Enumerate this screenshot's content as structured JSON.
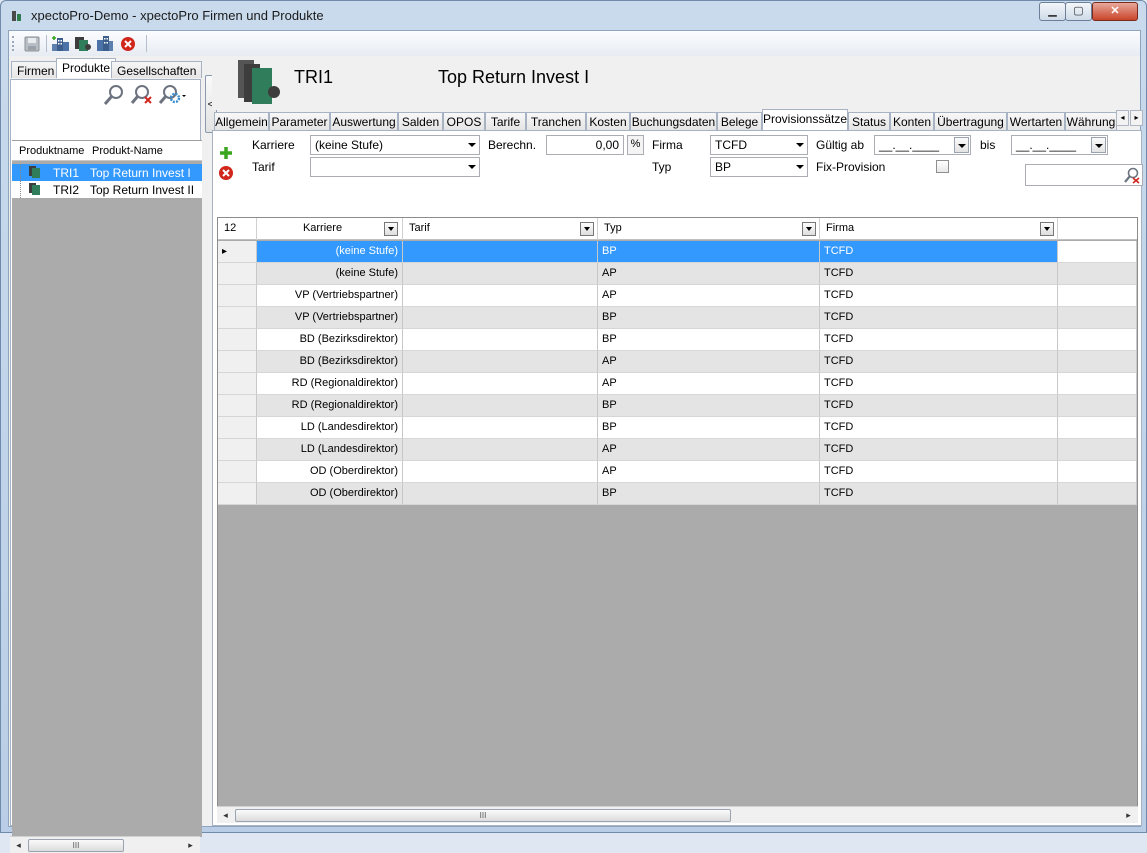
{
  "window": {
    "title": "xpectoPro-Demo - xpectoPro Firmen und Produkte",
    "min_glyph": "▁",
    "max_glyph": "▢",
    "close_glyph": "✕"
  },
  "left": {
    "tabs": [
      "Firmen",
      "Produkte",
      "Gesellschaften"
    ],
    "active_tab": "Produkte",
    "columns": [
      "Produktname",
      "Produkt-Name"
    ],
    "rows": [
      {
        "code": "TRI1",
        "name": "Top Return Invest I",
        "selected": true
      },
      {
        "code": "TRI2",
        "name": "Top Return Invest II",
        "selected": false
      }
    ],
    "scroll_thumb": "III"
  },
  "collapse_glyph": "<",
  "product": {
    "code": "TRI1",
    "name": "Top Return Invest I"
  },
  "tabs": [
    "Allgemein",
    "Parameter",
    "Auswertung",
    "Salden",
    "OPOS",
    "Tarife",
    "Tranchen",
    "Kosten",
    "Buchungsdaten",
    "Belege",
    "Provisionssätze",
    "Status",
    "Konten",
    "Übertragung",
    "Wertarten",
    "Währung"
  ],
  "active_tab": "Provisionssätze",
  "tab_nav": {
    "left": "◂",
    "right": "▸"
  },
  "filters": {
    "karriere_label": "Karriere",
    "karriere_value": "(keine Stufe)",
    "tarif_label": "Tarif",
    "tarif_value": "",
    "berechn_label": "Berechn.",
    "berechn_value": "0,00",
    "pct_label": "%",
    "firma_label": "Firma",
    "firma_value": "TCFD",
    "typ_label": "Typ",
    "typ_value": "BP",
    "gueltig_label": "Gültig ab",
    "gueltig_value": "__.__.____",
    "bis_label": "bis",
    "bis_value": "__.__.____",
    "fix_label": "Fix-Provision"
  },
  "grid": {
    "count": "12",
    "columns": [
      "Karriere",
      "Tarif",
      "Typ",
      "Firma"
    ],
    "rows": [
      {
        "karriere": "(keine Stufe)",
        "tarif": "",
        "typ": "BP",
        "firma": "TCFD"
      },
      {
        "karriere": "(keine Stufe)",
        "tarif": "",
        "typ": "AP",
        "firma": "TCFD"
      },
      {
        "karriere": "VP (Vertriebspartner)",
        "tarif": "",
        "typ": "AP",
        "firma": "TCFD"
      },
      {
        "karriere": "VP (Vertriebspartner)",
        "tarif": "",
        "typ": "BP",
        "firma": "TCFD"
      },
      {
        "karriere": "BD (Bezirksdirektor)",
        "tarif": "",
        "typ": "BP",
        "firma": "TCFD"
      },
      {
        "karriere": "BD (Bezirksdirektor)",
        "tarif": "",
        "typ": "AP",
        "firma": "TCFD"
      },
      {
        "karriere": "RD (Regionaldirektor)",
        "tarif": "",
        "typ": "AP",
        "firma": "TCFD"
      },
      {
        "karriere": "RD (Regionaldirektor)",
        "tarif": "",
        "typ": "BP",
        "firma": "TCFD"
      },
      {
        "karriere": "LD (Landesdirektor)",
        "tarif": "",
        "typ": "BP",
        "firma": "TCFD"
      },
      {
        "karriere": "LD (Landesdirektor)",
        "tarif": "",
        "typ": "AP",
        "firma": "TCFD"
      },
      {
        "karriere": "OD (Oberdirektor)",
        "tarif": "",
        "typ": "AP",
        "firma": "TCFD"
      },
      {
        "karriere": "OD (Oberdirektor)",
        "tarif": "",
        "typ": "BP",
        "firma": "TCFD"
      }
    ],
    "scroll_thumb": "III"
  },
  "icons": {
    "app": "app-icon",
    "save": "save-icon",
    "toolbar2": "building-add-icon",
    "toolbar3": "product-icon",
    "toolbar4": "building-icon",
    "toolbar5": "delete-icon",
    "add": "add-icon",
    "remove": "remove-icon"
  },
  "colors": {
    "selection": "#3399ff",
    "alt_row": "#e4e4e4",
    "grid_bg": "#ababab",
    "add_green": "#3aa61c",
    "delete_red": "#d0261c"
  }
}
